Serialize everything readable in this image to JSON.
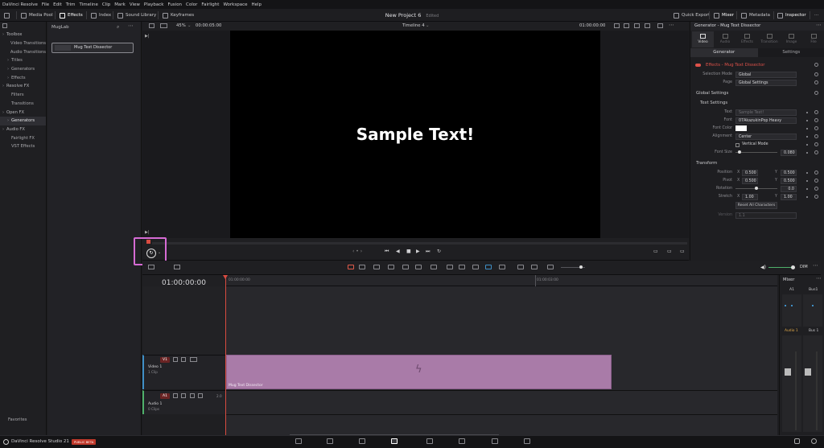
{
  "menubar": {
    "items": [
      "DaVinci Resolve",
      "File",
      "Edit",
      "Trim",
      "Timeline",
      "Clip",
      "Mark",
      "View",
      "Playback",
      "Fusion",
      "Color",
      "Fairlight",
      "Workspace",
      "Help"
    ]
  },
  "toolbar": {
    "media_pool": "Media Pool",
    "effects": "Effects",
    "index": "Index",
    "sound_library": "Sound Library",
    "keyframes": "Keyframes",
    "quick_export": "Quick Export",
    "mixer": "Mixer",
    "metadata": "Metadata",
    "inspector": "Inspector"
  },
  "project": {
    "title": "New Project 6",
    "status": "Edited"
  },
  "fx_tree": [
    {
      "label": "Toolbox",
      "hdr": true
    },
    {
      "label": "Video Transitions"
    },
    {
      "label": "Audio Transitions"
    },
    {
      "label": "Titles",
      "arrow": true
    },
    {
      "label": "Generators",
      "arrow": true
    },
    {
      "label": "Effects",
      "arrow": true
    },
    {
      "label": "Resolve FX",
      "hdr": true
    },
    {
      "label": "Filters"
    },
    {
      "label": "Transitions"
    },
    {
      "label": "Open FX",
      "hdr": true
    },
    {
      "label": "Generators",
      "arrow": true,
      "selected": true
    },
    {
      "label": "Audio FX",
      "hdr": true
    },
    {
      "label": "Fairlight FX"
    },
    {
      "label": "VST Effects"
    }
  ],
  "favorites": "Favorites",
  "fx_list": {
    "header": "MugLab",
    "item": "Mug Text Dissector"
  },
  "viewer": {
    "zoom": "45%",
    "duration": "00:00:05:00",
    "timeline_name": "Timeline 4",
    "timecode": "01:00:00:00",
    "text": "Sample Text!"
  },
  "inspector": {
    "title": "Generator - Mug Text Dissector",
    "tabs": [
      "Video",
      "Audio",
      "Effects",
      "Transition",
      "Image",
      "File"
    ],
    "subtabs": [
      "Generator",
      "Settings"
    ],
    "effect_name": "Effects - Mug Text Dissector",
    "selection_mode_label": "Selection Mode",
    "selection_mode": "Global",
    "page_label": "Page",
    "page": "Global Settings",
    "global_settings": "Global Settings",
    "text_settings": "Text Settings",
    "text_label": "Text",
    "text_placeholder": "Sample Text!",
    "font_label": "Font",
    "font": "07AkazukinPop Heavy",
    "font_color_label": "Font Color",
    "alignment_label": "Alignment",
    "alignment": "Center",
    "vertical_mode": "Vertical Mode",
    "font_size_label": "Font Size",
    "font_size": "0.080",
    "transform": "Transform",
    "position_label": "Position",
    "position_x": "0.500",
    "position_y": "0.500",
    "pivot_label": "Pivot",
    "pivot_x": "0.500",
    "pivot_y": "0.500",
    "rotation_label": "Rotation",
    "rotation": "0.0",
    "stretch_label": "Stretch",
    "stretch_x": "1.00",
    "stretch_y": "1.00",
    "reset_all": "Reset All Characters",
    "version_label": "Version",
    "version": "1.1",
    "x_label": "X",
    "y_label": "Y"
  },
  "timeline": {
    "timecode": "01:00:00:00",
    "ruler_start": "01:00:00:00",
    "ruler_mid": "01:00:03:00",
    "v1": {
      "tag": "V1",
      "name": "Video 1",
      "clips": "1 Clip"
    },
    "a1": {
      "tag": "A1",
      "name": "Audio 1",
      "clips": "0 Clips",
      "level": "2.0"
    },
    "clip_name": "Mug Text Dissector",
    "dim": "DIM"
  },
  "mixer": {
    "title": "Mixer",
    "ch1": "A1",
    "ch2": "Bus1",
    "name1": "Audio 1",
    "name2": "Bus 1"
  },
  "bottom": {
    "app": "DaVinci Resolve Studio 21",
    "beta": "PUBLIC BETA"
  },
  "colors": {
    "accent_pink": "#d66bd4",
    "clip": "#a97ba8",
    "playhead": "#d84b40",
    "effect_red": "#e0524a"
  }
}
